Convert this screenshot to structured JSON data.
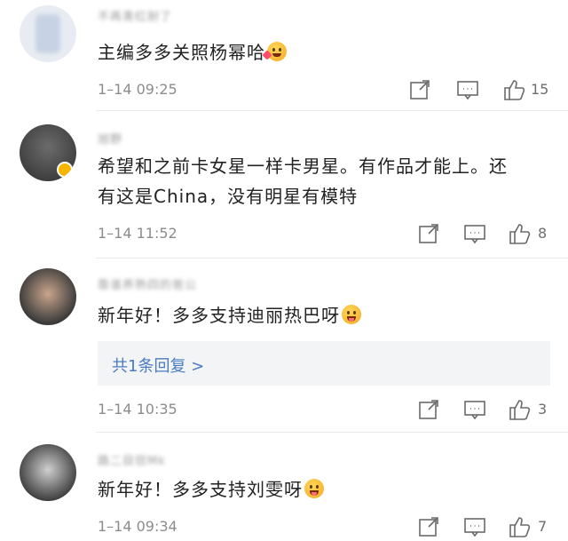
{
  "comments": [
    {
      "username": "不再青红耐了",
      "text": "主编多多关照杨幂哈",
      "emoji": "heart-face-emoji",
      "time": "1–14 09:25",
      "likes": "15"
    },
    {
      "username": "旭野",
      "text_line1": "希望和之前卡女星一样卡男星。有作品才能上。还",
      "text_line2": "有这是China，没有明星有模特",
      "time": "1–14 11:52",
      "likes": "8"
    },
    {
      "username": "靠谁养熟四的爸公",
      "text": "新年好！多多支持迪丽热巴呀",
      "emoji": "tongue-face-emoji",
      "reply_link": "共1条回复 >",
      "time": "1–14 10:35",
      "likes": "3"
    },
    {
      "username": "路二目钗Mk",
      "text": "新年好！多多支持刘雯呀",
      "emoji": "tongue-face-emoji",
      "time": "1–14 09:34",
      "likes": "7"
    }
  ],
  "icons": {
    "share": "share-icon",
    "comment": "comment-icon",
    "like": "thumbs-up-icon"
  },
  "colors": {
    "reply_link": "#4a7bc3",
    "meta": "#8c8c8c",
    "reply_bg": "#f3f4f6"
  }
}
